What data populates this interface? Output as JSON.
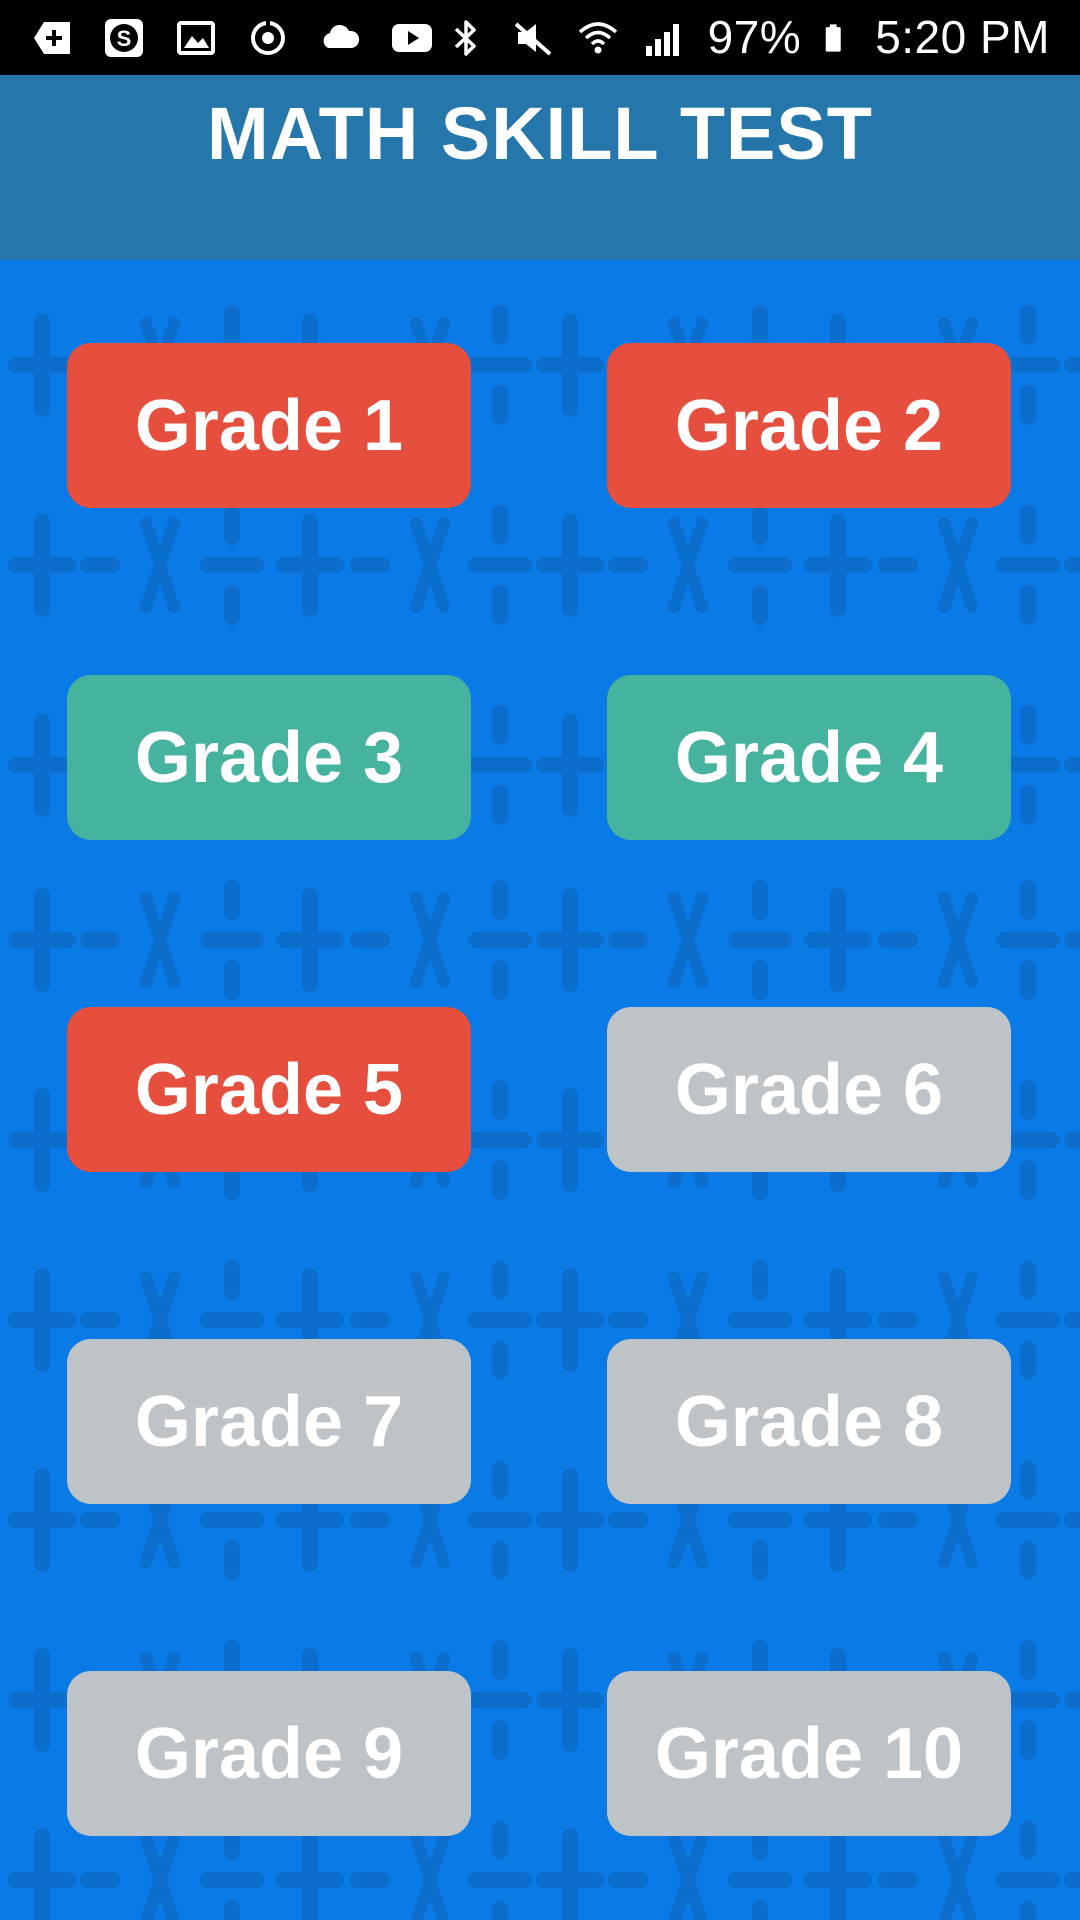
{
  "status_bar": {
    "left_icons": [
      "add-icon",
      "s-app-icon",
      "image-icon",
      "sync-icon",
      "cloud-icon",
      "youtube-icon"
    ],
    "right_icons": [
      "bluetooth-icon",
      "mute-icon",
      "wifi-icon",
      "signal-icon",
      "battery-icon"
    ],
    "battery": "97%",
    "time": "5:20 PM"
  },
  "header": {
    "title": "MATH SKILL TEST"
  },
  "colors": {
    "header_bg": "#2577ab",
    "content_bg": "#0a7ae6",
    "unlocked_red": "#e64e3d",
    "unlocked_green": "#45b39d",
    "locked_gray": "#bdc3c7"
  },
  "grades": [
    {
      "label": "Grade 1",
      "color": "#e64e3d",
      "state": "unlocked"
    },
    {
      "label": "Grade 2",
      "color": "#e64e3d",
      "state": "unlocked"
    },
    {
      "label": "Grade 3",
      "color": "#45b39d",
      "state": "unlocked"
    },
    {
      "label": "Grade 4",
      "color": "#45b39d",
      "state": "unlocked"
    },
    {
      "label": "Grade 5",
      "color": "#e64e3d",
      "state": "unlocked"
    },
    {
      "label": "Grade 6",
      "color": "#bdc3c7",
      "state": "locked"
    },
    {
      "label": "Grade 7",
      "color": "#bdc3c7",
      "state": "locked"
    },
    {
      "label": "Grade 8",
      "color": "#bdc3c7",
      "state": "locked"
    },
    {
      "label": "Grade 9",
      "color": "#bdc3c7",
      "state": "locked"
    },
    {
      "label": "Grade 10",
      "color": "#bdc3c7",
      "state": "locked"
    }
  ]
}
